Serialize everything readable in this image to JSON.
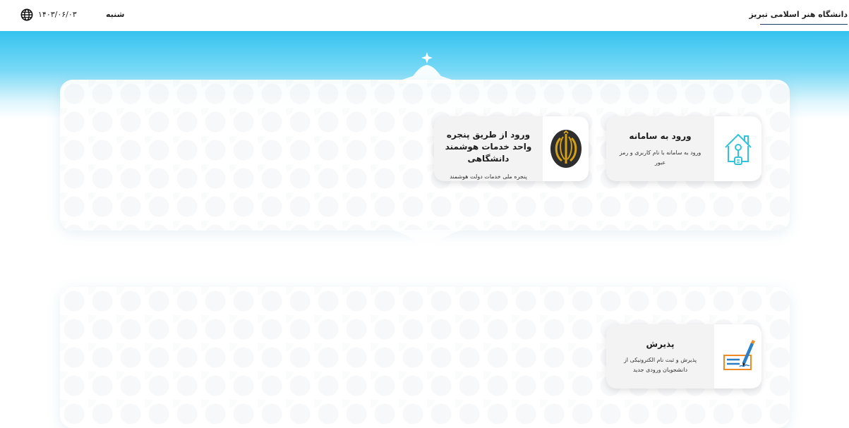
{
  "header": {
    "university_name": "دانشگاه هنر اسلامی تبریز",
    "day_name": "شنبه",
    "date": "۱۴۰۳/۰۶/۰۳",
    "language_icon": "globe-icon"
  },
  "cards": {
    "login": {
      "title": "ورود به سامانه",
      "description": "ورود به سامانه با نام کاربری و رمز عبور",
      "icon": "house-key-icon"
    },
    "smart_window": {
      "title": "ورود از طریق پنجره واحد خدمات هوشمند دانشگاهی",
      "description": "پنجره ملی خدمات دولت هوشمند",
      "icon": "iran-emblem-icon"
    },
    "admission": {
      "title": "پذیرش",
      "description": "پذیرش و ثبت نام الکترونیکی از دانشجویان ورودی جدید",
      "icon": "form-pen-icon"
    }
  },
  "colors": {
    "banner_top": "#35c3ef",
    "underline": "#1f3d63",
    "emblem_gold": "#d4a017",
    "icon_teal": "#35c3d9",
    "pen_blue": "#2a7fc6",
    "pen_orange": "#f08a24"
  }
}
